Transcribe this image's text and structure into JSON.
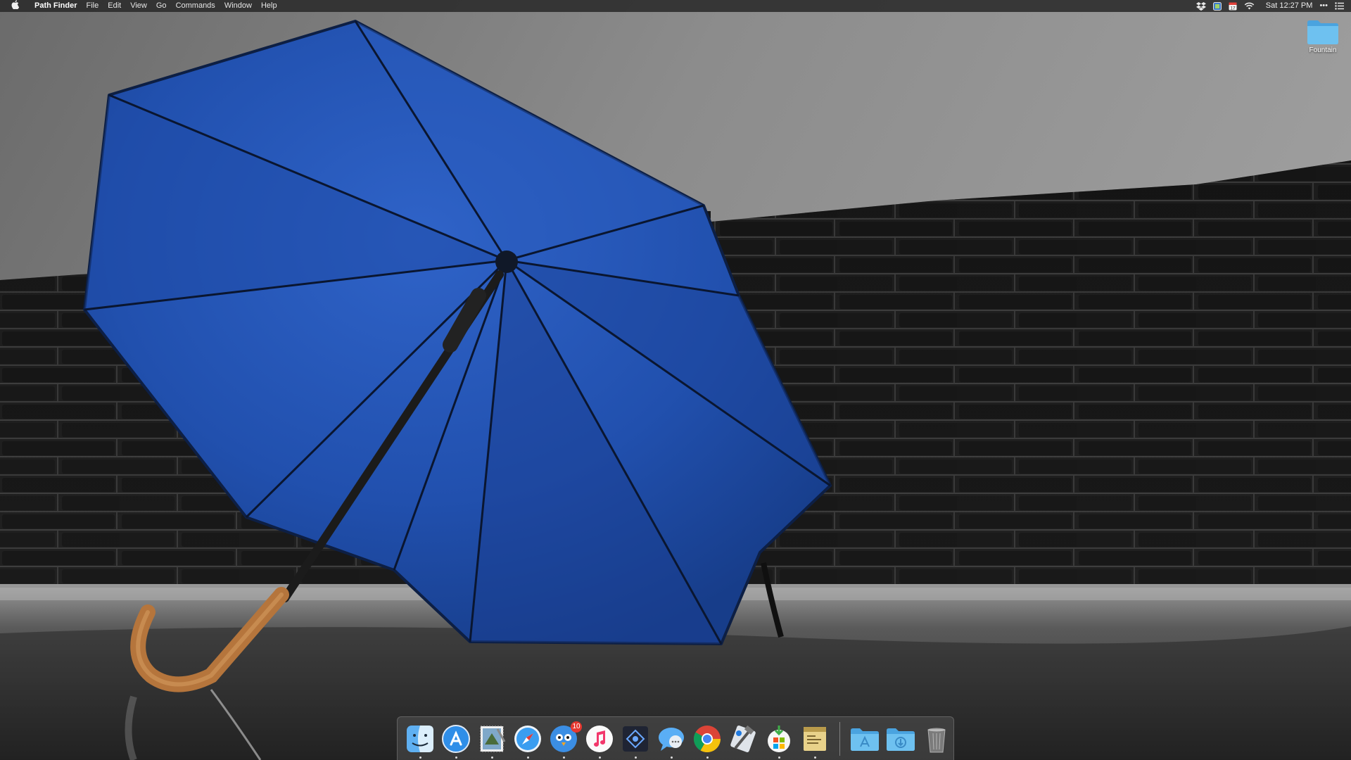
{
  "menubar": {
    "apple_glyph": "",
    "app_name": "Path Finder",
    "items": [
      "File",
      "Edit",
      "View",
      "Go",
      "Commands",
      "Window",
      "Help"
    ],
    "status_icons": [
      "dropbox-icon",
      "app-status-icon",
      "calendar-icon",
      "wifi-icon"
    ],
    "calendar_day": "17",
    "clock": "Sat 12:27 PM",
    "overflow_glyph": "•••",
    "notification_icon": "notification-center-icon"
  },
  "desktop": {
    "icons": [
      {
        "label": "Fountain",
        "icon": "folder-icon"
      }
    ],
    "wallpaper": "blue-umbrella-on-wet-ground-with-brick-wall"
  },
  "dock": {
    "items": [
      {
        "name": "finder",
        "icon": "finder-icon",
        "running": true
      },
      {
        "name": "app-store",
        "icon": "app-store-icon",
        "running": true
      },
      {
        "name": "mail-stamp",
        "icon": "stamp-icon",
        "running": true
      },
      {
        "name": "safari",
        "icon": "safari-compass-icon",
        "running": true
      },
      {
        "name": "tweetbot",
        "icon": "bird-icon",
        "running": true,
        "badge": "10"
      },
      {
        "name": "itunes",
        "icon": "music-note-icon",
        "running": true
      },
      {
        "name": "path-finder",
        "icon": "path-finder-icon",
        "running": true
      },
      {
        "name": "messages",
        "icon": "speech-bubble-icon",
        "running": true
      },
      {
        "name": "chrome",
        "icon": "chrome-icon",
        "running": true
      },
      {
        "name": "xcode",
        "icon": "hammer-icon",
        "running": false
      },
      {
        "name": "installer",
        "icon": "package-icon",
        "running": true
      },
      {
        "name": "notes",
        "icon": "notes-icon",
        "running": true
      }
    ],
    "stacks": [
      {
        "name": "applications-folder",
        "icon": "applications-folder-icon"
      },
      {
        "name": "downloads-folder",
        "icon": "downloads-folder-icon"
      },
      {
        "name": "trash",
        "icon": "trash-icon"
      }
    ]
  },
  "colors": {
    "menubar_bg": "#2a2a2a",
    "umbrella_blue": "#1f4fb0",
    "folder_blue": "#5cb3ea",
    "badge_red": "#e5372f"
  }
}
